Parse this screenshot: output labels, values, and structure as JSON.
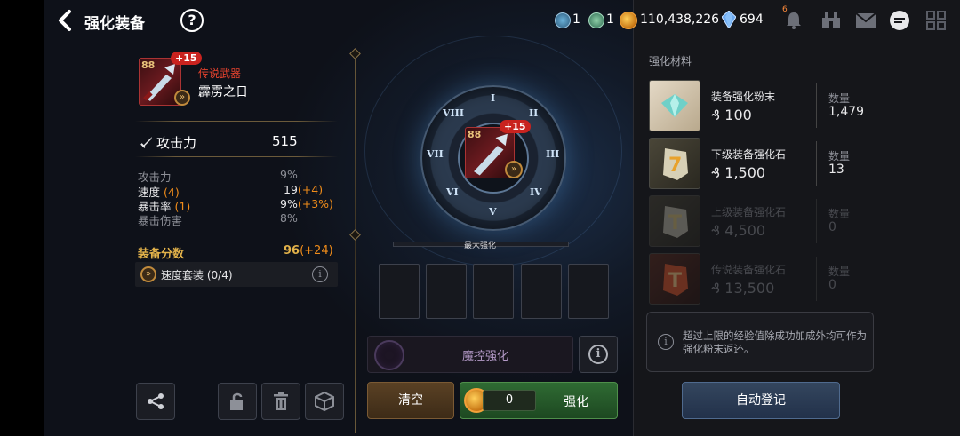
{
  "header": {
    "title": "强化装备",
    "help": "?",
    "resources": [
      {
        "icon": "ticket-icon",
        "value": "1"
      },
      {
        "icon": "ticket-icon",
        "value": "1"
      },
      {
        "icon": "gold-coin-icon",
        "value": "110,438,226"
      },
      {
        "icon": "crystal-icon",
        "value": "694"
      }
    ],
    "notification_badge": "6"
  },
  "item": {
    "level": "88",
    "plus": "+15",
    "rarity": "传说武器",
    "name": "霹雳之日",
    "main_stat_label": "攻击力",
    "main_stat_value": "515",
    "substats": [
      {
        "label": "攻击力",
        "value": "9%",
        "extra": "",
        "dim": true
      },
      {
        "label": "速度",
        "count": "(4)",
        "value": "19",
        "extra": "(+4)",
        "dim": false
      },
      {
        "label": "暴击率",
        "count": "(1)",
        "value": "9%",
        "extra": "(+3%)",
        "dim": false
      },
      {
        "label": "暴击伤害",
        "value": "8%",
        "extra": "",
        "dim": true
      }
    ],
    "gear_score_label": "装备分数",
    "gear_score_value": "96",
    "gear_score_extra": "(+24)",
    "set_label": "速度套装",
    "set_count": "(0/4)"
  },
  "center": {
    "numerals": [
      "I",
      "II",
      "III",
      "IV",
      "V",
      "VI",
      "VII",
      "VIII"
    ],
    "max_label": "最大强化",
    "magic_label": "魔控强化",
    "clear_label": "清空",
    "enhance_label": "强化",
    "enhance_count": "0"
  },
  "materials": {
    "title": "强化材料",
    "items": [
      {
        "name": "装备强化粉末",
        "cost": "100",
        "qty_label": "数量",
        "qty": "1,479",
        "active": true,
        "color": "#6fd0c8"
      },
      {
        "name": "下级装备强化石",
        "cost": "1,500",
        "qty_label": "数量",
        "qty": "13",
        "active": true,
        "color": "#e8b23a"
      },
      {
        "name": "上级装备强化石",
        "cost": "4,500",
        "qty_label": "数量",
        "qty": "0",
        "active": false,
        "color": "#d8c27a"
      },
      {
        "name": "传说装备强化石",
        "cost": "13,500",
        "qty_label": "数量",
        "qty": "0",
        "active": false,
        "color": "#e0542a"
      }
    ],
    "note": "超过上限的经验值除成功加成外均可作为强化粉末返还。",
    "auto_label": "自动登记"
  },
  "colors": {
    "accent_orange": "#f08c1a",
    "gold": "#e2b24a",
    "enhance_green": "#2f6b33",
    "auto_blue": "#34465e"
  }
}
